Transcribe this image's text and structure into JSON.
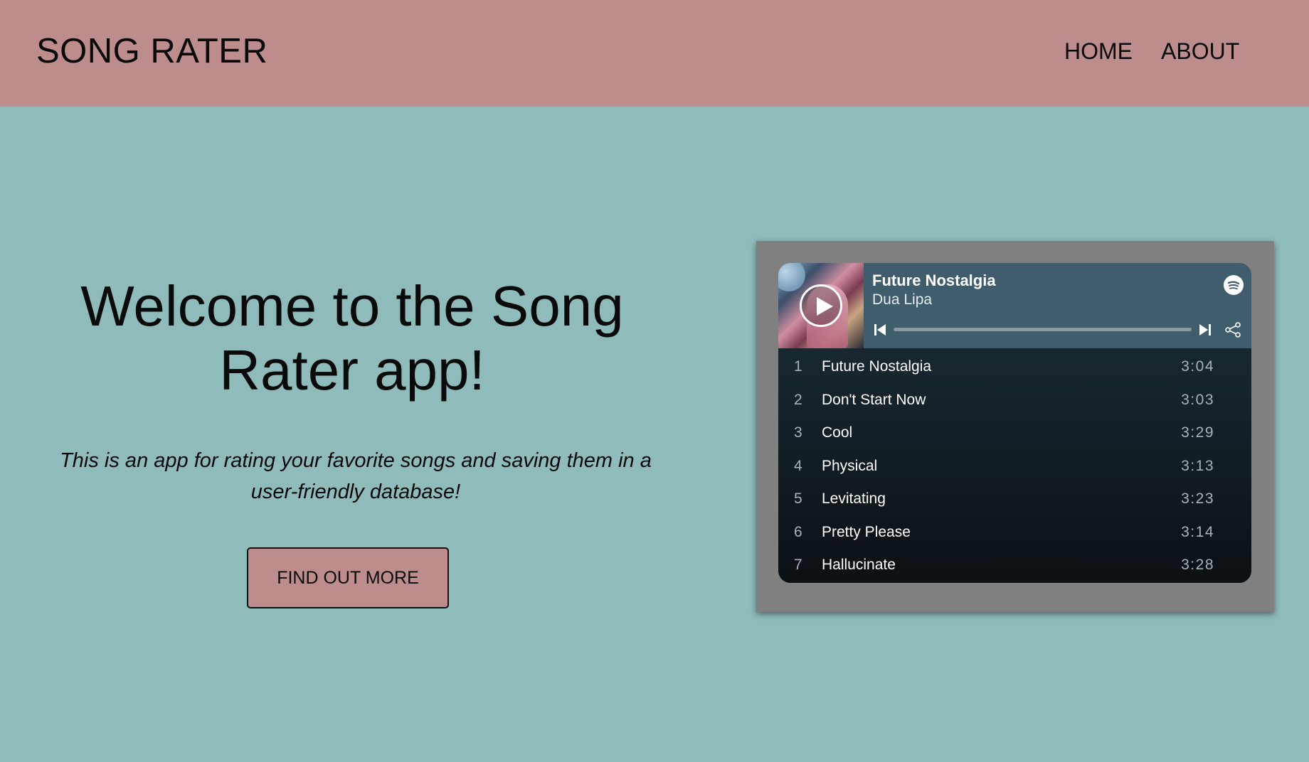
{
  "nav": {
    "brand": "SONG RATER",
    "links": [
      {
        "label": "HOME"
      },
      {
        "label": "ABOUT"
      }
    ]
  },
  "hero": {
    "title": "Welcome to the Song Rater app!",
    "subtitle": "This is an app for rating your favorite songs and saving them in a user-friendly database!",
    "button_label": "FIND OUT MORE"
  },
  "player": {
    "track_title": "Future Nostalgia",
    "artist": "Dua Lipa",
    "progress": 0,
    "icons": {
      "play": "play-icon",
      "brand": "spotify-icon",
      "previous": "skip-previous-icon",
      "next": "skip-next-icon",
      "share": "share-icon"
    },
    "tracks": [
      {
        "num": "1",
        "title": "Future Nostalgia",
        "duration": "3:04"
      },
      {
        "num": "2",
        "title": "Don't Start Now",
        "duration": "3:03"
      },
      {
        "num": "3",
        "title": "Cool",
        "duration": "3:29"
      },
      {
        "num": "4",
        "title": "Physical",
        "duration": "3:13"
      },
      {
        "num": "5",
        "title": "Levitating",
        "duration": "3:23"
      },
      {
        "num": "6",
        "title": "Pretty Please",
        "duration": "3:14"
      },
      {
        "num": "7",
        "title": "Hallucinate",
        "duration": "3:28"
      }
    ]
  },
  "colors": {
    "navbar": "#bd8c8c",
    "page_background": "#8fbbbb",
    "button": "#bd8c8c",
    "embed_frame": "#808080",
    "player_header": "#3f5d6c"
  }
}
